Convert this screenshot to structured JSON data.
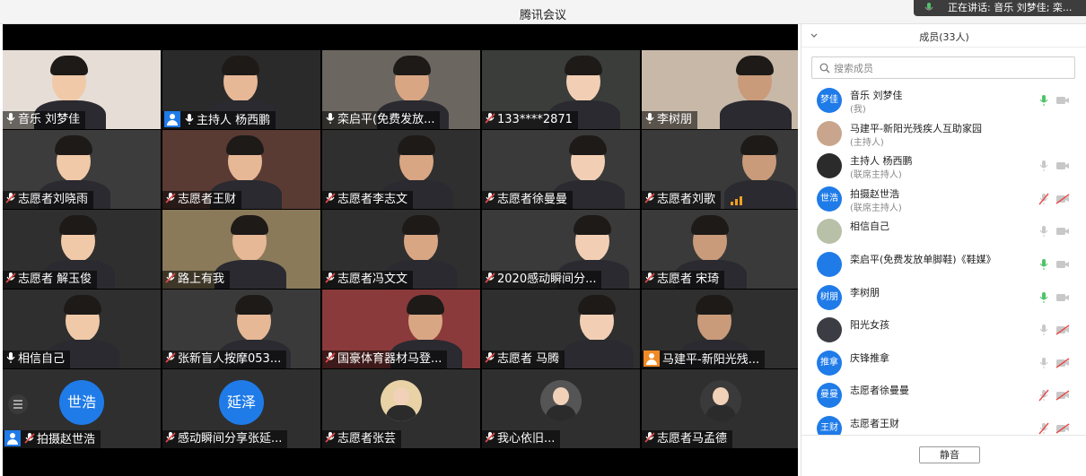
{
  "window": {
    "title": "腾讯会议"
  },
  "speaking": {
    "text": "正在讲话: 音乐  刘梦佳; 栾..."
  },
  "grid": {
    "tiles": [
      {
        "label": "音乐  刘梦佳",
        "mic": "on",
        "bg": "#e6ddd6"
      },
      {
        "label": "主持人 杨西鹏",
        "mic": "on",
        "host": true,
        "bg": "#2a2a2a"
      },
      {
        "label": "栾启平(免费发放...",
        "mic": "on",
        "bg": "#6b6660"
      },
      {
        "label": "133****2871",
        "mic": "off",
        "bg": "#3a3d3a"
      },
      {
        "label": "李树朋",
        "mic": "on",
        "bg": "#c8b8a8"
      },
      {
        "label": "志愿者刘晓雨",
        "mic": "off",
        "bg": "#3c3c3c"
      },
      {
        "label": "志愿者王财",
        "mic": "off",
        "bg": "#5a3b34"
      },
      {
        "label": "志愿者李志文",
        "mic": "off",
        "bg": "#2f2f2f"
      },
      {
        "label": "志愿者徐曼曼",
        "mic": "off",
        "bg": "#3a3a3a"
      },
      {
        "label": "志愿者刘歌",
        "mic": "off",
        "bg": "#3a3a3a",
        "signal": true
      },
      {
        "label": "志愿者  解玉俊",
        "mic": "off",
        "bg": "#2f2f2f"
      },
      {
        "label": "路上有我",
        "mic": "off",
        "bg": "#8a7a5a"
      },
      {
        "label": "志愿者冯文文",
        "mic": "off",
        "bg": "#2f2f2f"
      },
      {
        "label": "2020感动瞬间分...",
        "mic": "off",
        "bg": "#3a3a3a"
      },
      {
        "label": "志愿者 宋琦",
        "mic": "off",
        "bg": "#3a3a3a"
      },
      {
        "label": "相信自己",
        "mic": "on",
        "bg": "#2f2f2f"
      },
      {
        "label": "张新盲人按摩053...",
        "mic": "off",
        "bg": "#3a3a3a"
      },
      {
        "label": "国豪体育器材马登...",
        "mic": "off",
        "bg": "#8a3a3a"
      },
      {
        "label": "志愿者 马腾",
        "mic": "off",
        "bg": "#2f2f2f"
      },
      {
        "label": "马建平-新阳光残...",
        "mic": "none",
        "orange": true,
        "bg": "#2f2f2f"
      },
      {
        "label": "拍摄赵世浩",
        "mic": "off",
        "host": true,
        "avatarText": "世浩",
        "bg": "#2f2f2f"
      },
      {
        "label": "感动瞬间分享张延...",
        "mic": "off",
        "avatarText": "延泽",
        "bg": "#2f2f2f"
      },
      {
        "label": "志愿者张芸",
        "mic": "off",
        "avatarImg": "#e8d2a6",
        "bg": "#2f2f2f"
      },
      {
        "label": "我心依旧...",
        "mic": "off",
        "avatarImg": "#555",
        "bg": "#2f2f2f"
      },
      {
        "label": "志愿者马孟德",
        "mic": "off",
        "avatarImg": "#3a3a3a",
        "bg": "#2f2f2f"
      }
    ]
  },
  "panel": {
    "title": "成员(33人)",
    "search_placeholder": "搜索成员",
    "mute_label": "静音",
    "members": [
      {
        "name": "音乐  刘梦佳",
        "role": "(我)",
        "avatar": "梦佳",
        "avatarColor": "#1f7be8",
        "mic": "active",
        "cam": "on"
      },
      {
        "name": "马建平-新阳光残疾人互助家园",
        "role": "(主持人)",
        "avatar": "",
        "avatarColor": "#c9a58d",
        "mic": "none",
        "cam": "none"
      },
      {
        "name": "主持人 杨西鹏",
        "role": "(联席主持人)",
        "avatar": "",
        "avatarColor": "#2b2b2b",
        "mic": "on",
        "cam": "on"
      },
      {
        "name": "拍摄赵世浩",
        "role": "(联席主持人)",
        "avatar": "世浩",
        "avatarColor": "#1f7be8",
        "mic": "muted",
        "cam": "off"
      },
      {
        "name": "相信自己",
        "role": "",
        "avatar": "",
        "avatarColor": "#b8c0a8",
        "mic": "on",
        "cam": "on"
      },
      {
        "name": "栾启平(免费发放单脚鞋)《鞋媒》",
        "role": "",
        "avatar": "",
        "avatarColor": "#1f7be8",
        "mic": "active",
        "cam": "on"
      },
      {
        "name": "李树朋",
        "role": "",
        "avatar": "树朋",
        "avatarColor": "#1f7be8",
        "mic": "active",
        "cam": "on"
      },
      {
        "name": "阳光女孩",
        "role": "",
        "avatar": "",
        "avatarColor": "#3c3c44",
        "mic": "on",
        "cam": "off"
      },
      {
        "name": "庆锋推拿",
        "role": "",
        "avatar": "推拿",
        "avatarColor": "#1f7be8",
        "mic": "on",
        "cam": "off"
      },
      {
        "name": "志愿者徐曼曼",
        "role": "",
        "avatar": "曼曼",
        "avatarColor": "#1f7be8",
        "mic": "muted",
        "cam": "off"
      },
      {
        "name": "志愿者王财",
        "role": "",
        "avatar": "王财",
        "avatarColor": "#1f7be8",
        "mic": "muted",
        "cam": "off"
      }
    ]
  }
}
